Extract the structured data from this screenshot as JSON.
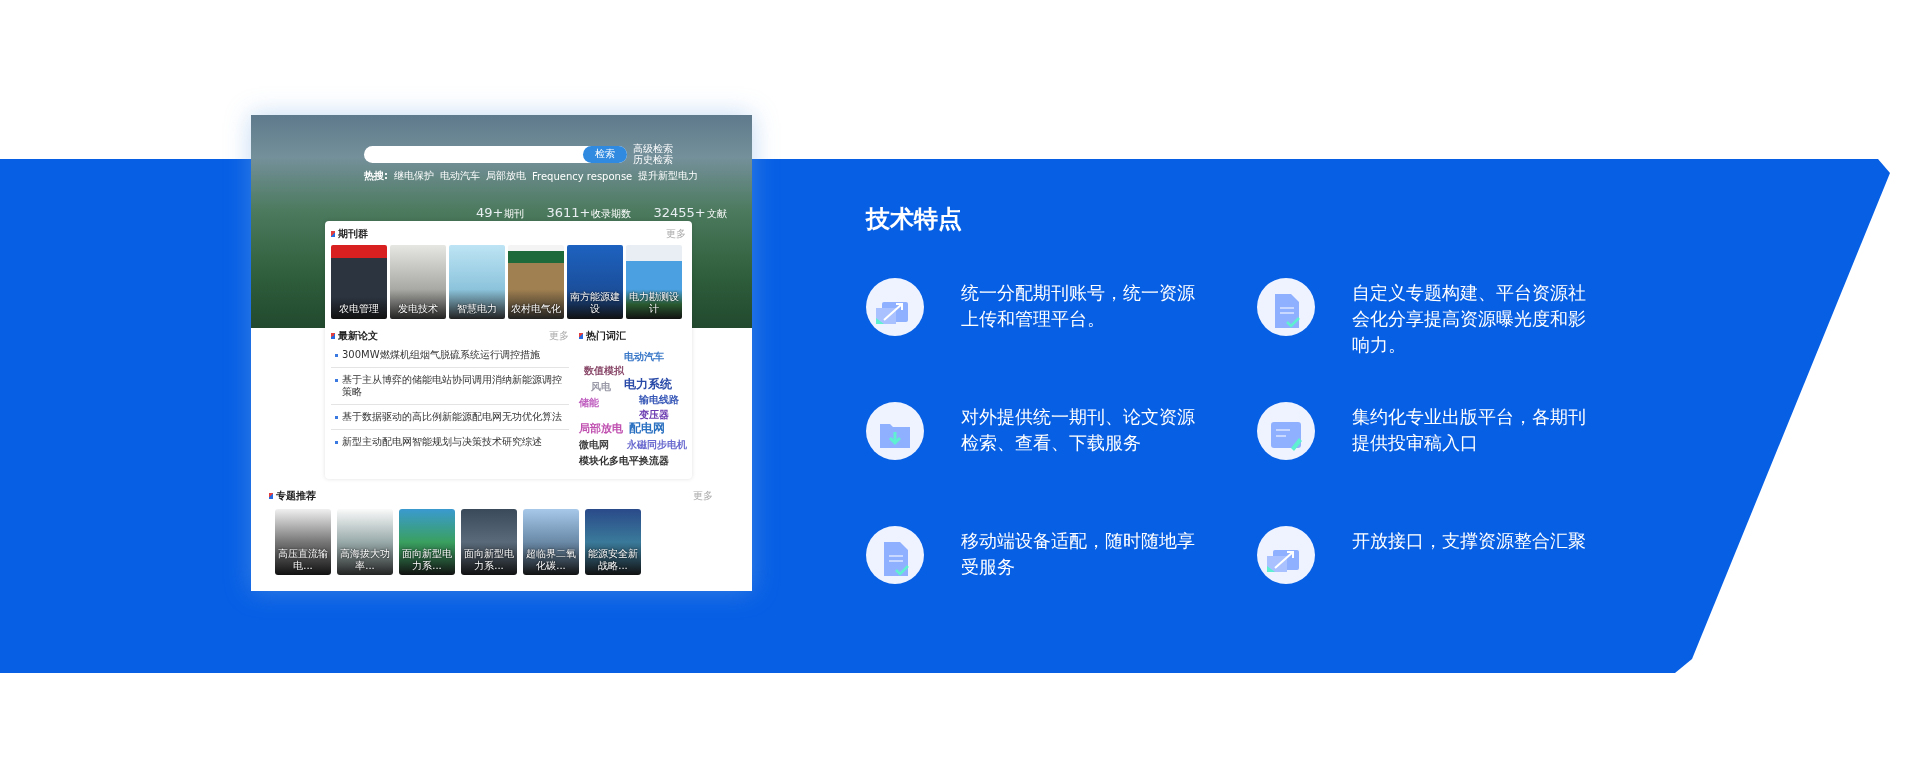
{
  "screenshot": {
    "search": {
      "button": "检索",
      "links": [
        "高级检索",
        "历史检索"
      ]
    },
    "hot_searches": {
      "label": "热搜:",
      "items": [
        "继电保护",
        "电动汽车",
        "局部放电",
        "Frequency response",
        "提升新型电力"
      ]
    },
    "stats": [
      {
        "value": "49+",
        "label": "期刊"
      },
      {
        "value": "3611+",
        "label": "收录期数"
      },
      {
        "value": "32455+",
        "label": "文献"
      }
    ],
    "journals": {
      "title": "期刊群",
      "more": "更多",
      "items": [
        "农电管理",
        "发电技术",
        "智慧电力",
        "农村电气化",
        "南方能源建设",
        "电力勘测设计"
      ]
    },
    "papers": {
      "title": "最新论文",
      "more": "更多",
      "items": [
        "300MW燃煤机组烟气脱硫系统运行调控措施",
        "基于主从博弈的储能电站协同调用消纳新能源调控策略",
        "基于数据驱动的高比例新能源配电网无功优化算法",
        "新型主动配电网智能规划与决策技术研究综述"
      ]
    },
    "hot_words": {
      "title": "热门词汇",
      "items": [
        {
          "text": "电动汽车",
          "color": "#3a78c8"
        },
        {
          "text": "数值模拟",
          "color": "#8a4a6a"
        },
        {
          "text": "风电",
          "color": "#9a9aa8"
        },
        {
          "text": "电力系统",
          "color": "#2a4aa8"
        },
        {
          "text": "储能",
          "color": "#c060c0"
        },
        {
          "text": "输电线路",
          "color": "#3a5ab8"
        },
        {
          "text": "变压器",
          "color": "#6a3ab0"
        },
        {
          "text": "局部放电",
          "color": "#c050b0"
        },
        {
          "text": "配电网",
          "color": "#2a70c0"
        },
        {
          "text": "微电网",
          "color": "#444444"
        },
        {
          "text": "永磁同步电机",
          "color": "#6a6ad0"
        },
        {
          "text": "模块化多电平换流器",
          "color": "#333333"
        }
      ]
    },
    "topics": {
      "title": "专题推荐",
      "more": "更多",
      "items": [
        "高压直流输电...",
        "高海拔大功率...",
        "面向新型电力系...",
        "面向新型电力系...",
        "超临界二氧化碳...",
        "能源安全新战略..."
      ]
    }
  },
  "section_title": "技术特点",
  "features": [
    "统一分配期刊账号，统一资源上传和管理平台。",
    "自定义专题构建、平台资源社会化分享提高资源曝光度和影响力。",
    "对外提供统一期刊、论文资源检索、查看、下载服务",
    "集约化专业出版平台，各期刊提供投审稿入口",
    "移动端设备适配，随时随地享受服务",
    "开放接口，支撑资源整合汇聚"
  ]
}
